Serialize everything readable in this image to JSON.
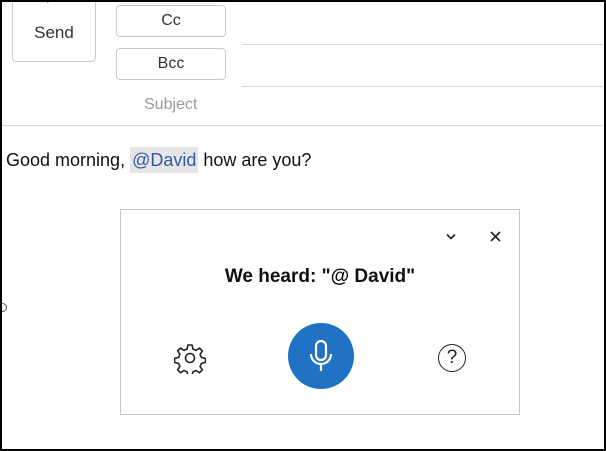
{
  "compose": {
    "send_label": "Send",
    "send_accesskey": "S",
    "cc_label": "Cc",
    "bcc_label": "Bcc",
    "subject_placeholder": "Subject"
  },
  "message": {
    "prefix": "Good morning, ",
    "mention": "@David",
    "suffix": " how are you?"
  },
  "dictation": {
    "heard_text": "We heard: \"@ David\"",
    "minimize_icon": "chevron-down-icon",
    "close_icon": "close-icon",
    "settings_icon": "gear-icon",
    "mic_icon": "microphone-icon",
    "help_icon": "help-icon",
    "help_glyph": "?",
    "accent_color": "#1f72c4"
  }
}
